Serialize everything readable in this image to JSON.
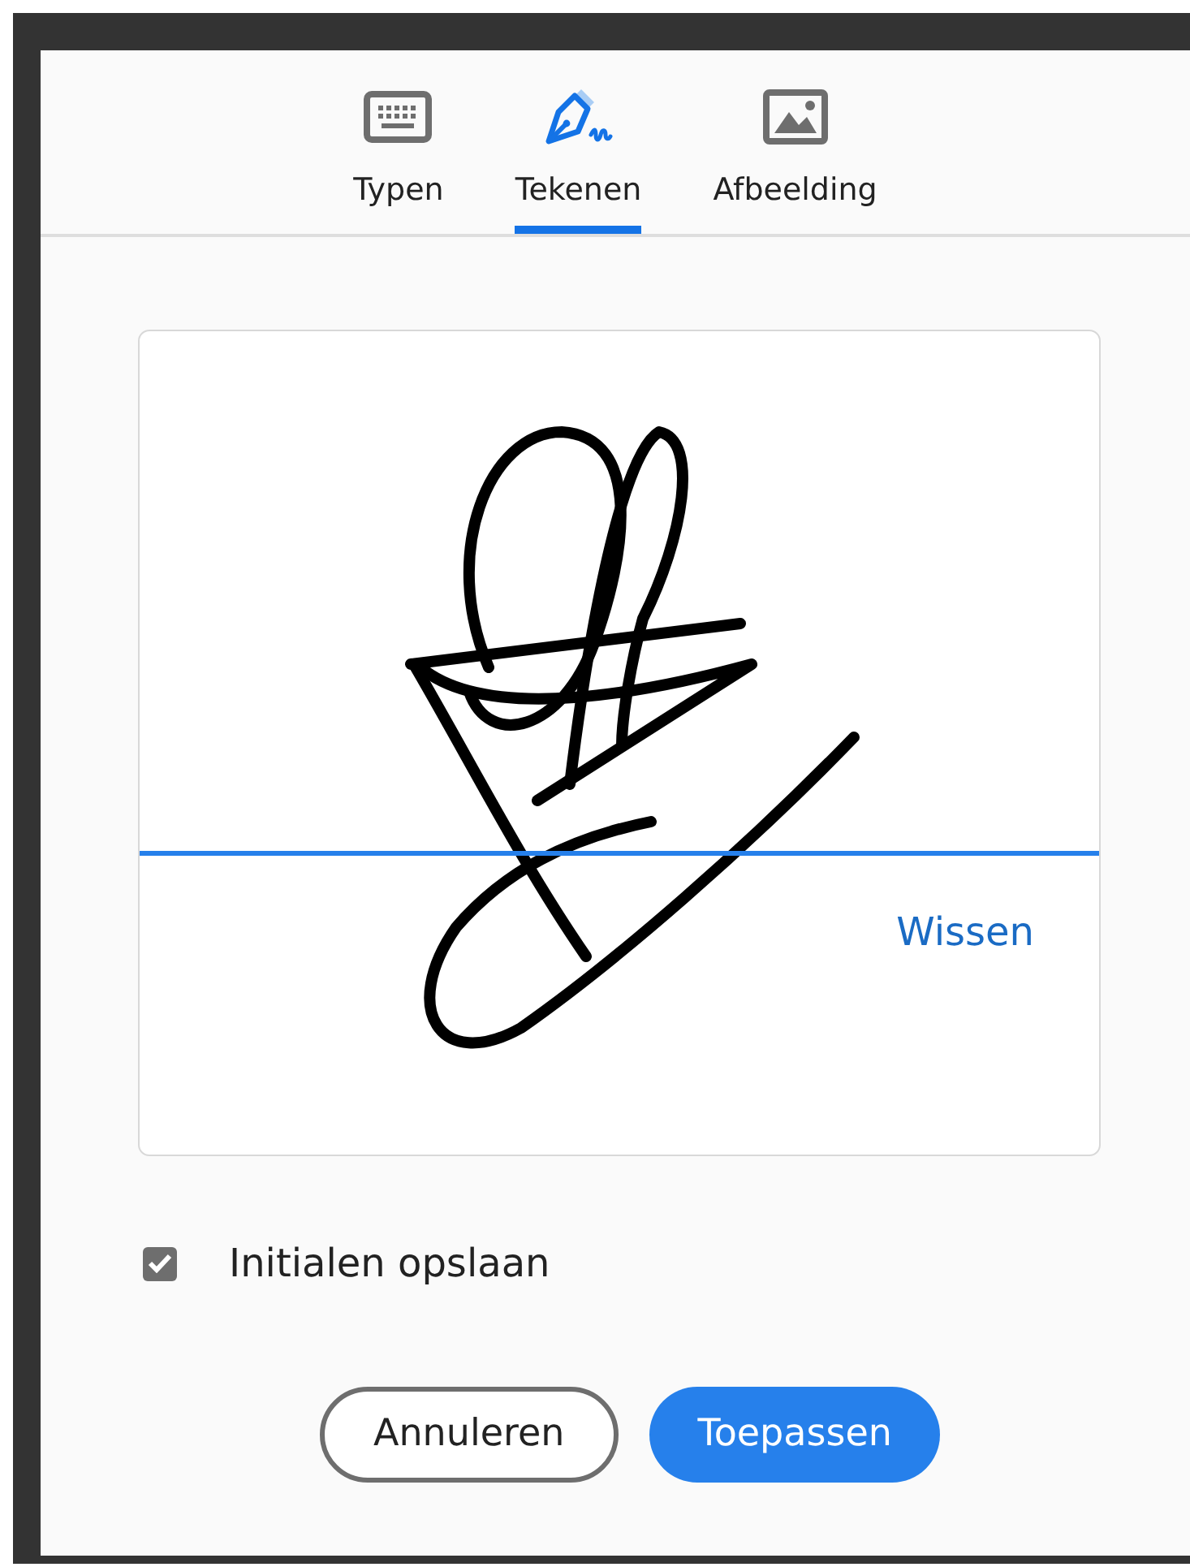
{
  "tabs": [
    {
      "label": "Typen",
      "selected": false
    },
    {
      "label": "Tekenen",
      "selected": true
    },
    {
      "label": "Afbeelding",
      "selected": false
    }
  ],
  "draw_area": {
    "clear_link": "Wissen"
  },
  "save_initials": {
    "label": "Initialen opslaan",
    "checked": true
  },
  "buttons": [
    {
      "label": "Annuleren",
      "kind": "secondary"
    },
    {
      "label": "Toepassen",
      "kind": "primary"
    }
  ]
}
